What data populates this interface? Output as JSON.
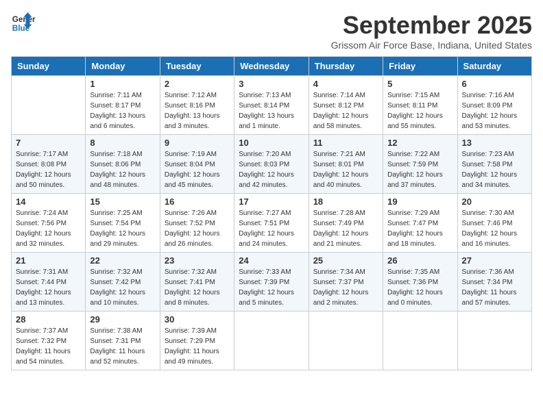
{
  "header": {
    "logo_line1": "General",
    "logo_line2": "Blue",
    "month": "September 2025",
    "location": "Grissom Air Force Base, Indiana, United States"
  },
  "days_of_week": [
    "Sunday",
    "Monday",
    "Tuesday",
    "Wednesday",
    "Thursday",
    "Friday",
    "Saturday"
  ],
  "weeks": [
    [
      {
        "day": "",
        "info": ""
      },
      {
        "day": "1",
        "info": "Sunrise: 7:11 AM\nSunset: 8:17 PM\nDaylight: 13 hours\nand 6 minutes."
      },
      {
        "day": "2",
        "info": "Sunrise: 7:12 AM\nSunset: 8:16 PM\nDaylight: 13 hours\nand 3 minutes."
      },
      {
        "day": "3",
        "info": "Sunrise: 7:13 AM\nSunset: 8:14 PM\nDaylight: 13 hours\nand 1 minute."
      },
      {
        "day": "4",
        "info": "Sunrise: 7:14 AM\nSunset: 8:12 PM\nDaylight: 12 hours\nand 58 minutes."
      },
      {
        "day": "5",
        "info": "Sunrise: 7:15 AM\nSunset: 8:11 PM\nDaylight: 12 hours\nand 55 minutes."
      },
      {
        "day": "6",
        "info": "Sunrise: 7:16 AM\nSunset: 8:09 PM\nDaylight: 12 hours\nand 53 minutes."
      }
    ],
    [
      {
        "day": "7",
        "info": "Sunrise: 7:17 AM\nSunset: 8:08 PM\nDaylight: 12 hours\nand 50 minutes."
      },
      {
        "day": "8",
        "info": "Sunrise: 7:18 AM\nSunset: 8:06 PM\nDaylight: 12 hours\nand 48 minutes."
      },
      {
        "day": "9",
        "info": "Sunrise: 7:19 AM\nSunset: 8:04 PM\nDaylight: 12 hours\nand 45 minutes."
      },
      {
        "day": "10",
        "info": "Sunrise: 7:20 AM\nSunset: 8:03 PM\nDaylight: 12 hours\nand 42 minutes."
      },
      {
        "day": "11",
        "info": "Sunrise: 7:21 AM\nSunset: 8:01 PM\nDaylight: 12 hours\nand 40 minutes."
      },
      {
        "day": "12",
        "info": "Sunrise: 7:22 AM\nSunset: 7:59 PM\nDaylight: 12 hours\nand 37 minutes."
      },
      {
        "day": "13",
        "info": "Sunrise: 7:23 AM\nSunset: 7:58 PM\nDaylight: 12 hours\nand 34 minutes."
      }
    ],
    [
      {
        "day": "14",
        "info": "Sunrise: 7:24 AM\nSunset: 7:56 PM\nDaylight: 12 hours\nand 32 minutes."
      },
      {
        "day": "15",
        "info": "Sunrise: 7:25 AM\nSunset: 7:54 PM\nDaylight: 12 hours\nand 29 minutes."
      },
      {
        "day": "16",
        "info": "Sunrise: 7:26 AM\nSunset: 7:52 PM\nDaylight: 12 hours\nand 26 minutes."
      },
      {
        "day": "17",
        "info": "Sunrise: 7:27 AM\nSunset: 7:51 PM\nDaylight: 12 hours\nand 24 minutes."
      },
      {
        "day": "18",
        "info": "Sunrise: 7:28 AM\nSunset: 7:49 PM\nDaylight: 12 hours\nand 21 minutes."
      },
      {
        "day": "19",
        "info": "Sunrise: 7:29 AM\nSunset: 7:47 PM\nDaylight: 12 hours\nand 18 minutes."
      },
      {
        "day": "20",
        "info": "Sunrise: 7:30 AM\nSunset: 7:46 PM\nDaylight: 12 hours\nand 16 minutes."
      }
    ],
    [
      {
        "day": "21",
        "info": "Sunrise: 7:31 AM\nSunset: 7:44 PM\nDaylight: 12 hours\nand 13 minutes."
      },
      {
        "day": "22",
        "info": "Sunrise: 7:32 AM\nSunset: 7:42 PM\nDaylight: 12 hours\nand 10 minutes."
      },
      {
        "day": "23",
        "info": "Sunrise: 7:32 AM\nSunset: 7:41 PM\nDaylight: 12 hours\nand 8 minutes."
      },
      {
        "day": "24",
        "info": "Sunrise: 7:33 AM\nSunset: 7:39 PM\nDaylight: 12 hours\nand 5 minutes."
      },
      {
        "day": "25",
        "info": "Sunrise: 7:34 AM\nSunset: 7:37 PM\nDaylight: 12 hours\nand 2 minutes."
      },
      {
        "day": "26",
        "info": "Sunrise: 7:35 AM\nSunset: 7:36 PM\nDaylight: 12 hours\nand 0 minutes."
      },
      {
        "day": "27",
        "info": "Sunrise: 7:36 AM\nSunset: 7:34 PM\nDaylight: 11 hours\nand 57 minutes."
      }
    ],
    [
      {
        "day": "28",
        "info": "Sunrise: 7:37 AM\nSunset: 7:32 PM\nDaylight: 11 hours\nand 54 minutes."
      },
      {
        "day": "29",
        "info": "Sunrise: 7:38 AM\nSunset: 7:31 PM\nDaylight: 11 hours\nand 52 minutes."
      },
      {
        "day": "30",
        "info": "Sunrise: 7:39 AM\nSunset: 7:29 PM\nDaylight: 11 hours\nand 49 minutes."
      },
      {
        "day": "",
        "info": ""
      },
      {
        "day": "",
        "info": ""
      },
      {
        "day": "",
        "info": ""
      },
      {
        "day": "",
        "info": ""
      }
    ]
  ]
}
